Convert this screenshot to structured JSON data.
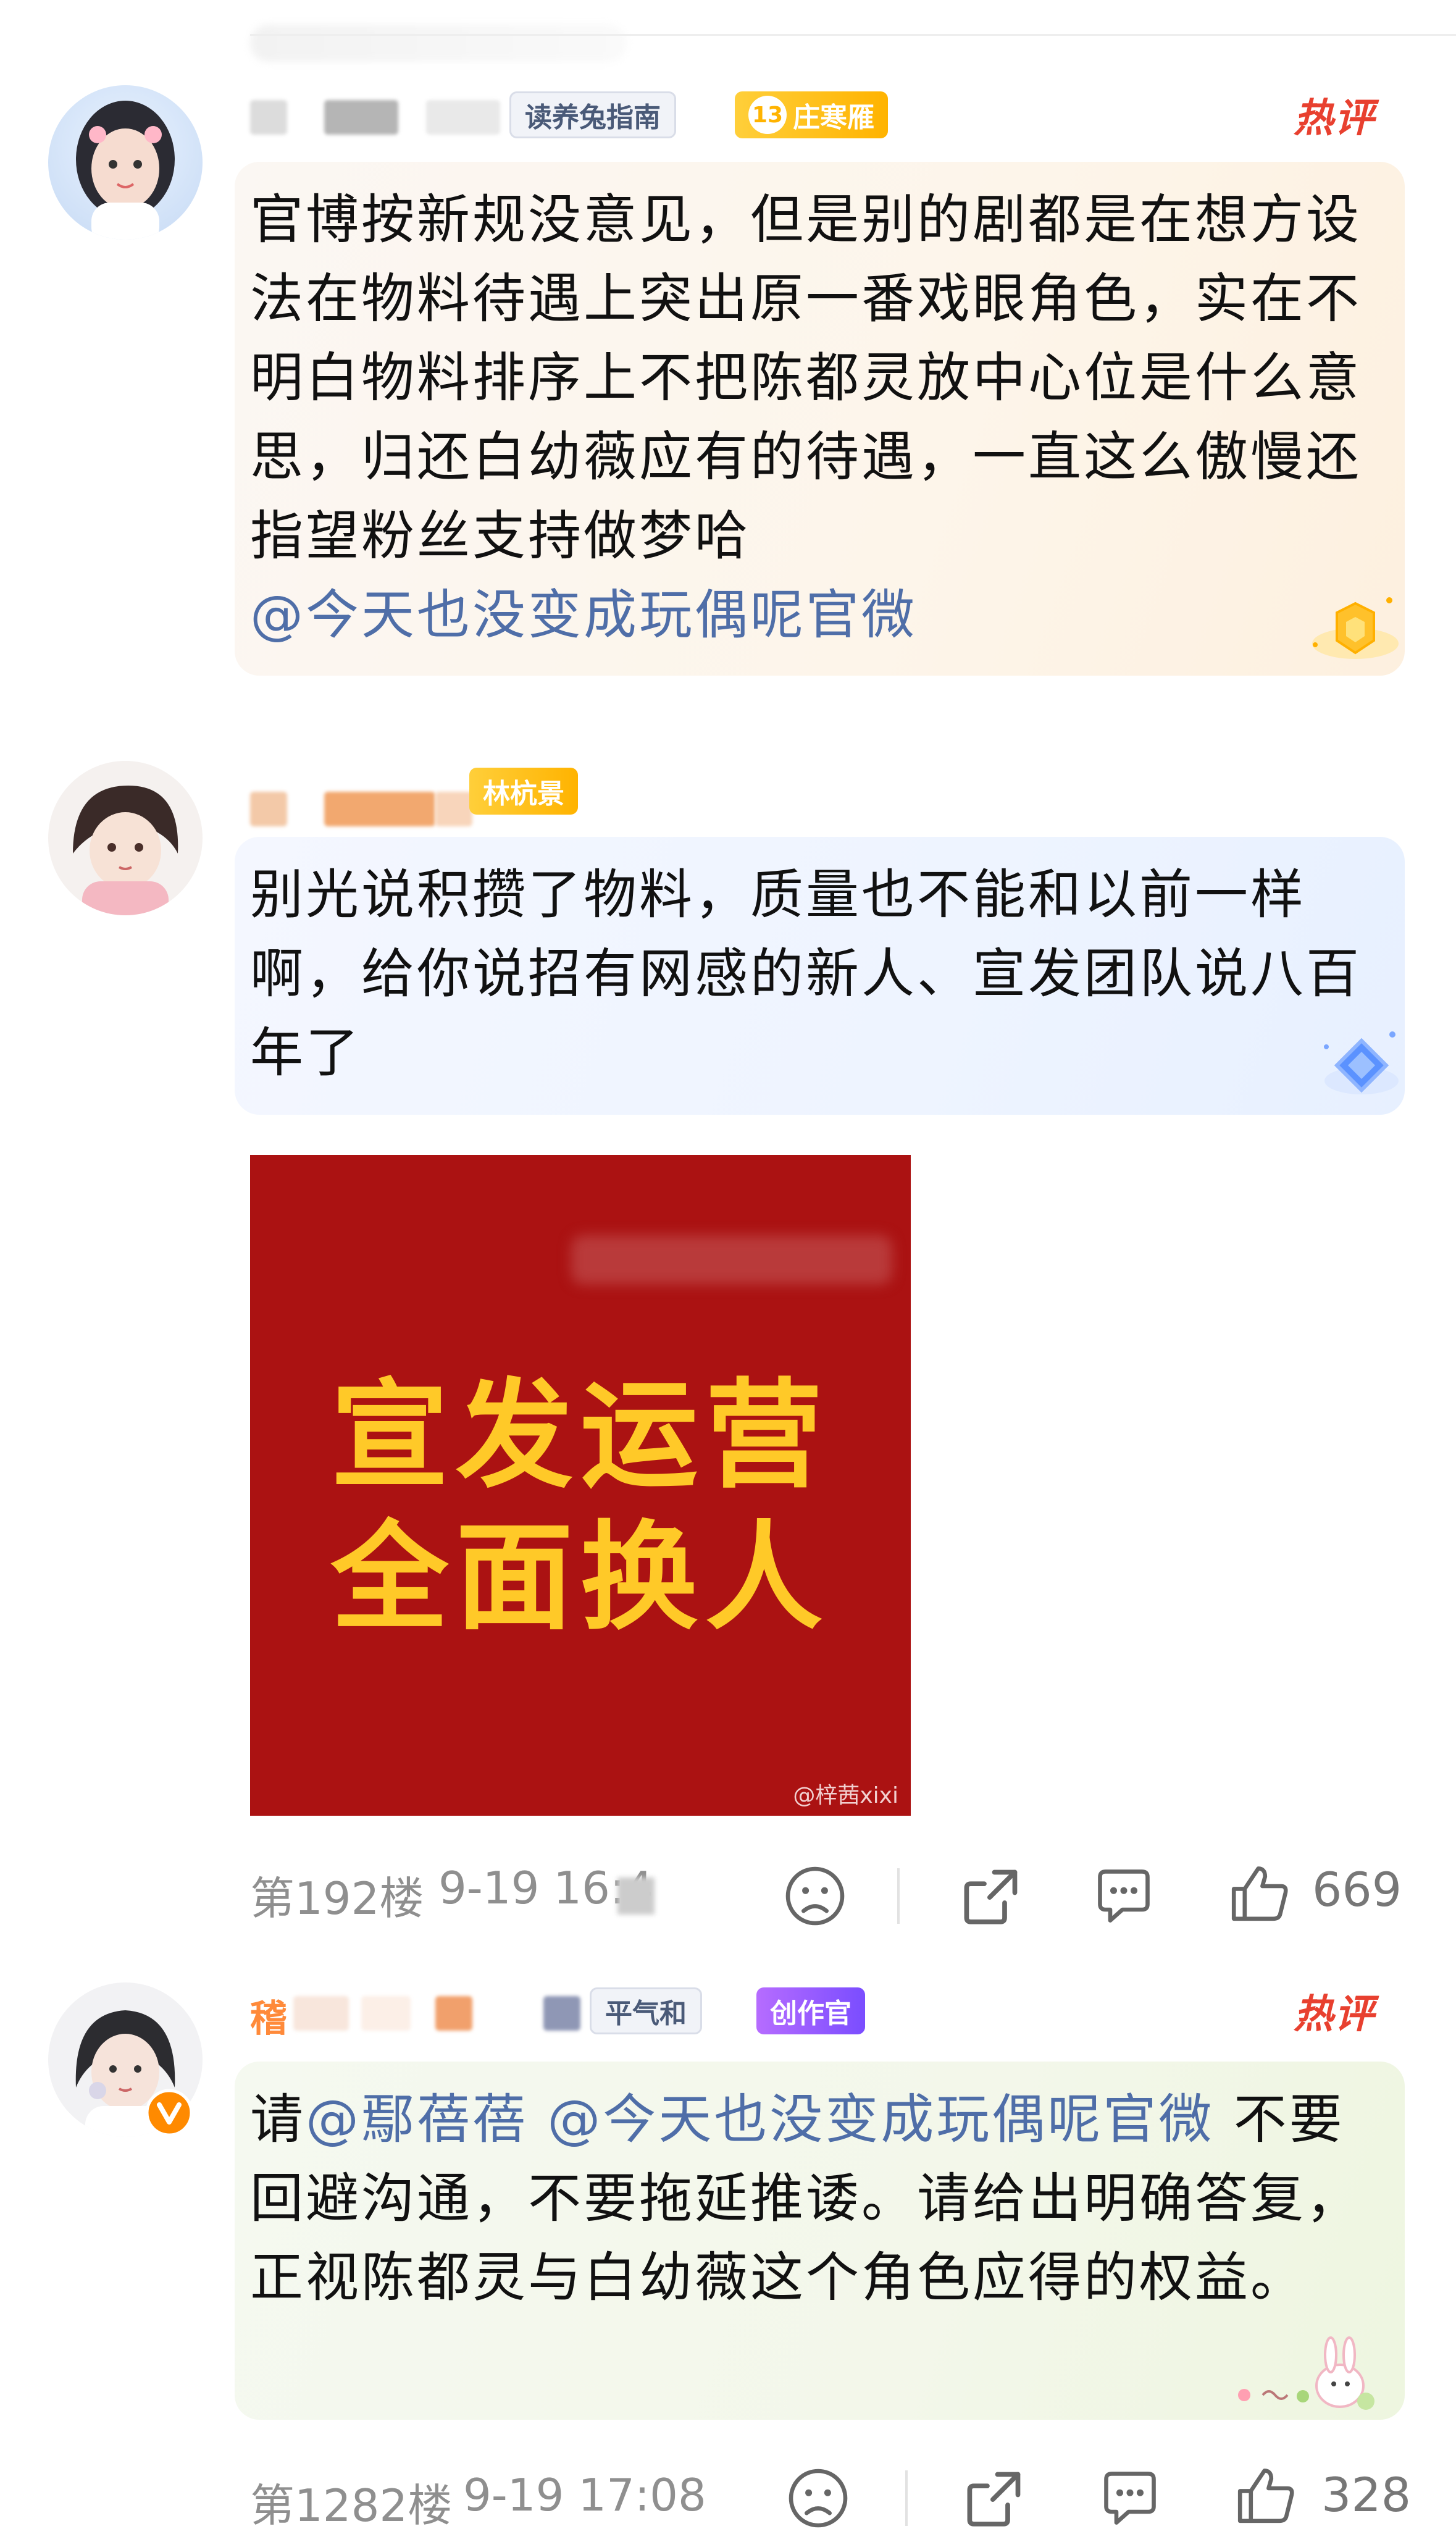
{
  "comments": [
    {
      "badges": [
        {
          "text": "读养兔指南"
        },
        {
          "level": "13",
          "text": "庄寒雁"
        }
      ],
      "hot_label": "热评",
      "text_segments": [
        {
          "t": "官博按新规没意见，但是别的剧都是在想方设法在物料待遇上突出原一番戏眼角色，实在不明白物料排序上不把陈都灵放中心位是什么意思，归还白幼薇应有的待遇，一直这么傲慢还指望粉丝支持做梦哈",
          "mention": false
        },
        {
          "t": "@今天也没变成玩偶呢官微",
          "mention": true
        }
      ]
    },
    {
      "badges": [
        {
          "text": "林杭景"
        }
      ],
      "text": "别光说积攒了物料，质量也不能和以前一样啊，给你说招有网感的新人、宣发团队说八百年了",
      "image": {
        "line1": "宣发运营",
        "line2": "全面换人",
        "watermark": "@梓茜xixi"
      },
      "floor": "第192楼",
      "time": "9-19 16:4",
      "likes": "669"
    },
    {
      "name_fragment": "稽",
      "badges": [
        {
          "text": "平气和"
        },
        {
          "text": "创作官"
        }
      ],
      "hot_label": "热评",
      "text_segments": [
        {
          "t": "请",
          "mention": false
        },
        {
          "t": "@鄢蓓蓓",
          "mention": true
        },
        {
          "t": " ",
          "mention": false
        },
        {
          "t": "@今天也没变成玩偶呢官微",
          "mention": true
        },
        {
          "t": " 不要回避沟通，不要拖延推诿。请给出明确答复，正视陈都灵与白幼薇这个角色应得的权益。",
          "mention": false
        }
      ],
      "floor": "第1282楼",
      "time": "9-19 17:08",
      "likes": "328"
    }
  ],
  "icons": [
    "sad-face-icon",
    "share-icon",
    "comment-icon",
    "like-icon",
    "crown-badge-icon",
    "diamond-badge-icon",
    "verified-v-icon",
    "bunny-sticker-icon"
  ],
  "colors": {
    "hot": "#e8402f",
    "mention": "#4f6ea8",
    "promo_bg": "#ab1212",
    "promo_text": "#ffc928",
    "verified": "#ff8a00"
  }
}
